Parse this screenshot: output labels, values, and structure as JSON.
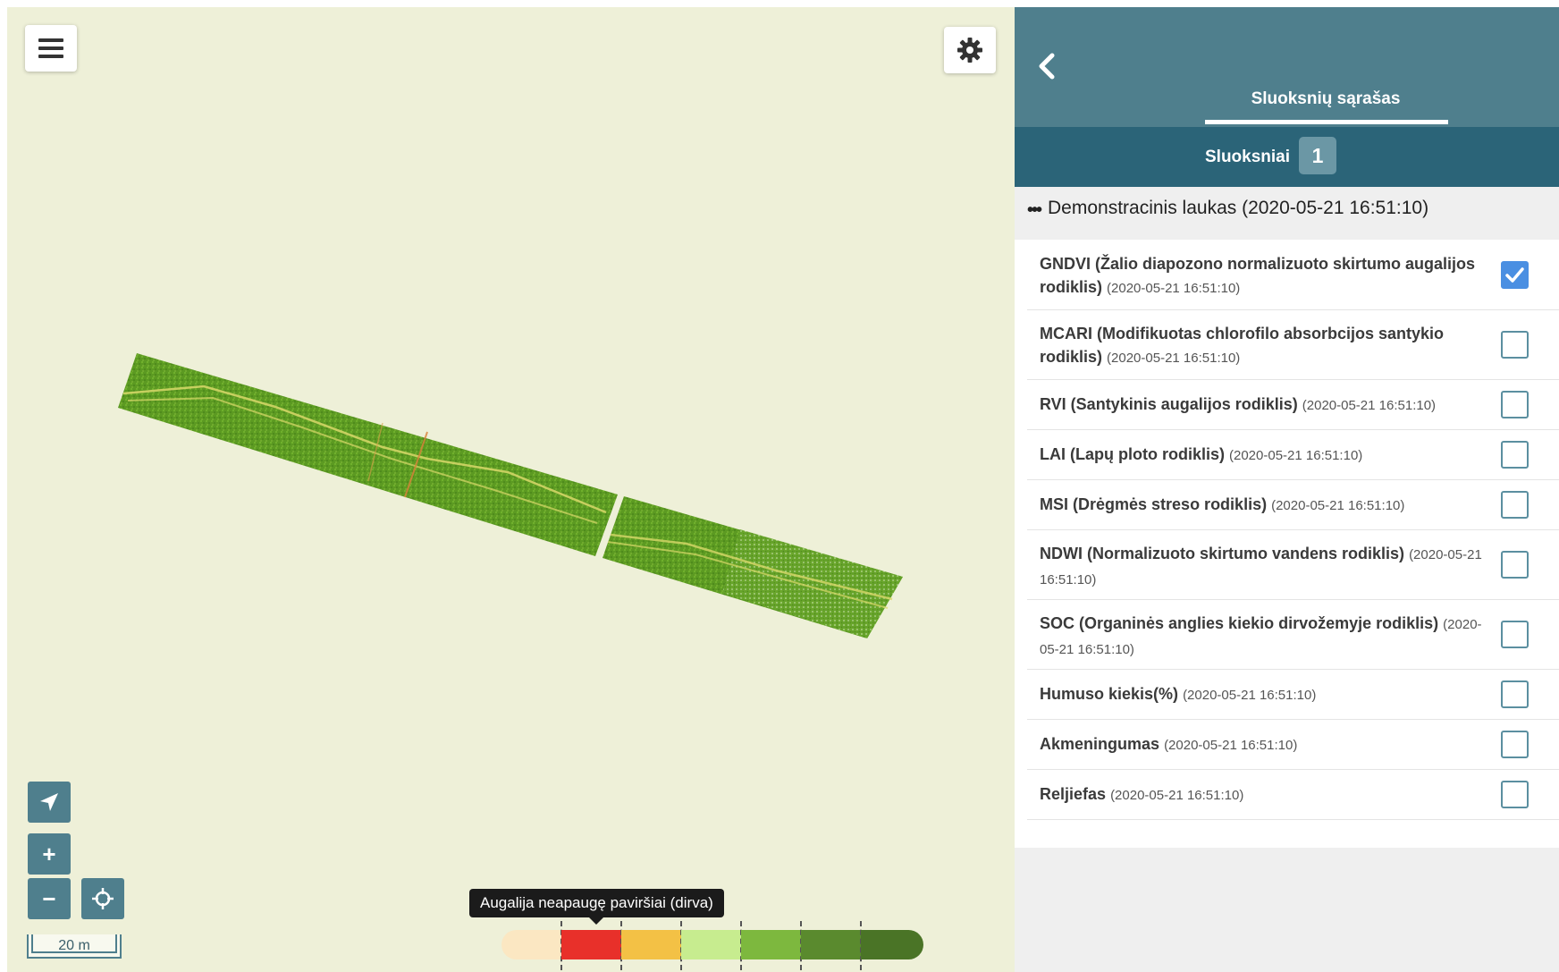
{
  "map": {
    "menu_icon": "hamburger-menu-icon",
    "settings_icon": "gear-icon",
    "locate_icon": "navigation-arrow-icon",
    "zoom_in_label": "+",
    "zoom_out_label": "−",
    "center_icon": "crosshair-icon",
    "scale_label": "20 m",
    "tooltip": "Augalija neapaugę paviršiai (dirva)",
    "legend_colors": [
      "#fbe7c2",
      "#e8302a",
      "#f3c145",
      "#c7ec8f",
      "#7db83e",
      "#5a8a2e",
      "#4a7426"
    ]
  },
  "panel": {
    "back_icon": "chevron-left-icon",
    "tab_title": "Sluoksnių sąrašas",
    "sub_label": "Sluoksniai",
    "sub_count": "1",
    "group_dots": "•••",
    "group_title": "Demonstracinis laukas (2020-05-21 16:51:10)",
    "layers": [
      {
        "name": "GNDVI (Žalio diapozono normalizuoto skirtumo augalijos rodiklis)",
        "date": "(2020-05-21 16:51:10)",
        "checked": true
      },
      {
        "name": "MCARI (Modifikuotas chlorofilo absorbcijos santykio rodiklis)",
        "date": "(2020-05-21 16:51:10)",
        "checked": false
      },
      {
        "name": "RVI (Santykinis augalijos rodiklis)",
        "date": "(2020-05-21 16:51:10)",
        "checked": false
      },
      {
        "name": "LAI (Lapų ploto rodiklis)",
        "date": "(2020-05-21 16:51:10)",
        "checked": false
      },
      {
        "name": "MSI (Drėgmės streso rodiklis)",
        "date": "(2020-05-21 16:51:10)",
        "checked": false
      },
      {
        "name": "NDWI (Normalizuoto skirtumo vandens rodiklis)",
        "date": "(2020-05-21 16:51:10)",
        "checked": false
      },
      {
        "name": "SOC (Organinės anglies kiekio dirvožemyje rodiklis)",
        "date": "(2020-05-21 16:51:10)",
        "checked": false
      },
      {
        "name": "Humuso kiekis(%)",
        "date": "(2020-05-21 16:51:10)",
        "checked": false
      },
      {
        "name": "Akmeningumas",
        "date": "(2020-05-21 16:51:10)",
        "checked": false
      },
      {
        "name": "Reljiefas",
        "date": "(2020-05-21 16:51:10)",
        "checked": false
      }
    ]
  }
}
